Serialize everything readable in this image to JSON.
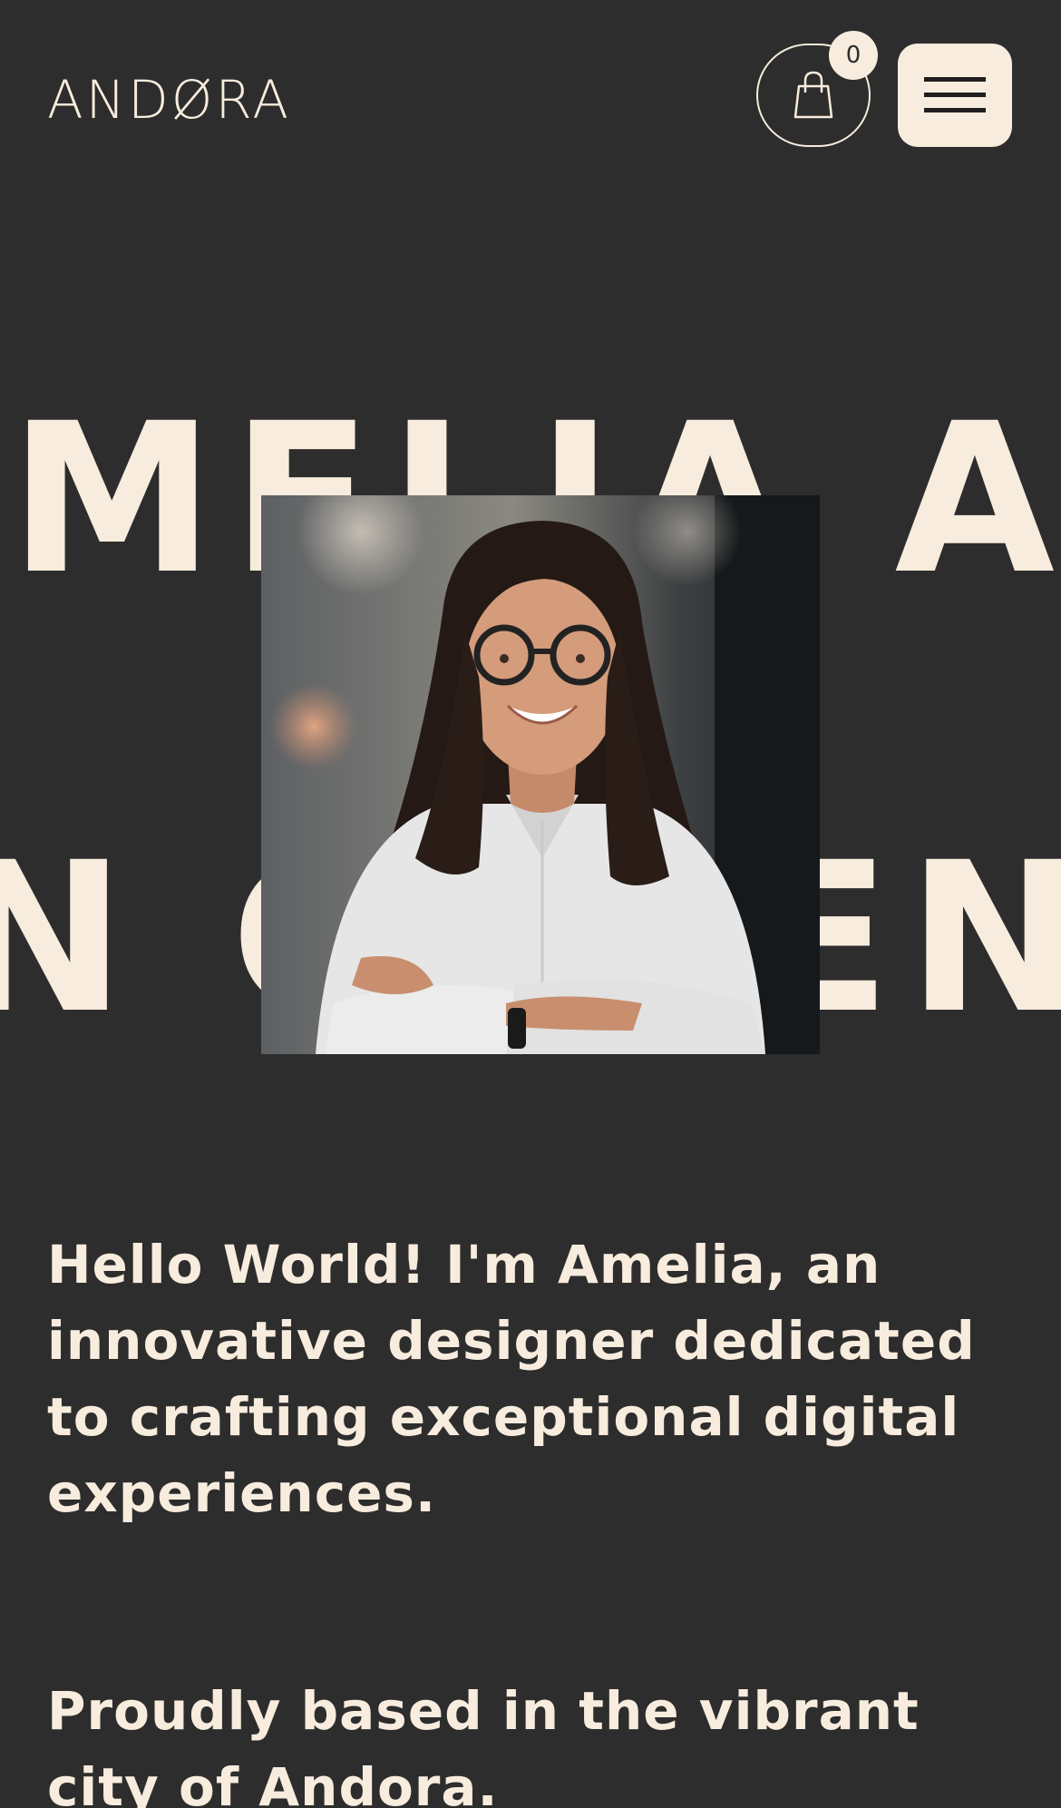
{
  "header": {
    "logo_text": "ANDØRA",
    "cart_count": "0",
    "cart_icon": "shopping-bag-icon",
    "menu_icon": "hamburger-menu-icon"
  },
  "hero": {
    "line1": "MELIA A",
    "line2": "N GREEN",
    "photo_alt": "Portrait of Amelia"
  },
  "about": {
    "intro": "Hello World! I'm Amelia, an innovative designer dedicated to crafting exceptional digital experiences.",
    "based": "Proudly based in the vibrant city of Andora."
  },
  "colors": {
    "background": "#2d2d2d",
    "cream": "#f7ecdd"
  }
}
